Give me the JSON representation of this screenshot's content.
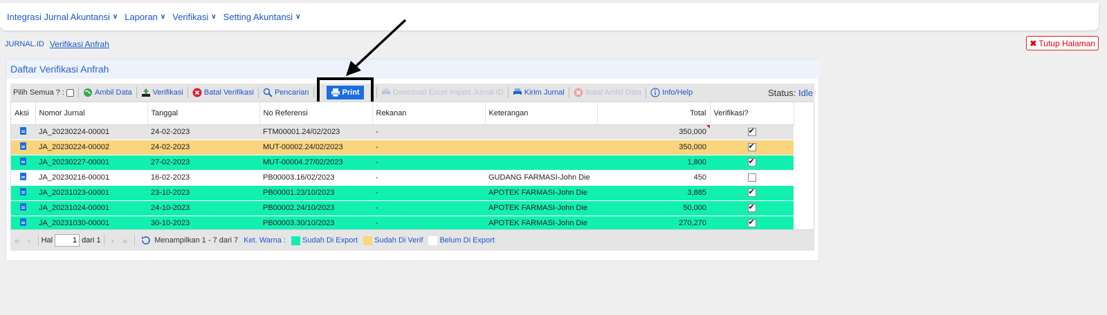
{
  "topnav": {
    "menus": [
      {
        "label": "Integrasi Jurnal Akuntansi"
      },
      {
        "label": "Laporan"
      },
      {
        "label": "Verifikasi"
      },
      {
        "label": "Setting Akuntansi"
      }
    ]
  },
  "breadcrumb": {
    "root": "JURNAL.ID",
    "current": "Verifikasi Anfrah"
  },
  "close_button": {
    "label": "Tutup Halaman"
  },
  "panel": {
    "title": "Daftar Verifikasi Anfrah"
  },
  "toolbar": {
    "select_all_label": "Pilih Semua ? :",
    "ambil_data": "Ambil Data",
    "verifikasi": "Verifikasi",
    "batal_verifikasi": "Batal Verifikasi",
    "pencarian": "Pencarian",
    "print": "Print",
    "download_excel": "Download Excel Import Jurnal ID",
    "kirim_jurnal": "Kirim Jurnal",
    "batal_ambil_data": "Batal Ambil Data",
    "info_help": "Info/Help",
    "status_label": "Status:",
    "status_value": "Idle"
  },
  "grid": {
    "columns": [
      "Aksi",
      "Nomor Jurnal",
      "Tanggal",
      "No Referensi",
      "Rekanan",
      "Keterangan",
      "Total",
      "Verifikasi?"
    ],
    "rows": [
      {
        "nomor": "JA_20230224-00001",
        "tanggal": "24-02-2023",
        "ref": "FTM00001.24/02/2023",
        "rekanan": "-",
        "keterangan": "",
        "total": "350,000",
        "verif": true,
        "bg": "#e5e5e5"
      },
      {
        "nomor": "JA_20230224-00002",
        "tanggal": "24-02-2023",
        "ref": "MUT-00002.24/02/2023",
        "rekanan": "-",
        "keterangan": "",
        "total": "350,000",
        "verif": true,
        "bg": "#fbd47e"
      },
      {
        "nomor": "JA_20230227-00001",
        "tanggal": "27-02-2023",
        "ref": "MUT-00004.27/02/2023",
        "rekanan": "-",
        "keterangan": "",
        "total": "1,800",
        "verif": true,
        "bg": "#12f0b0"
      },
      {
        "nomor": "JA_20230216-00001",
        "tanggal": "16-02-2023",
        "ref": "PB00003.16/02/2023",
        "rekanan": "-",
        "keterangan": "GUDANG FARMASI-John Die",
        "total": "450",
        "verif": false,
        "bg": "#ffffff"
      },
      {
        "nomor": "JA_20231023-00001",
        "tanggal": "23-10-2023",
        "ref": "PB00001.23/10/2023",
        "rekanan": "-",
        "keterangan": "APOTEK FARMASI-John Die",
        "total": "3,885",
        "verif": true,
        "bg": "#12f0b0"
      },
      {
        "nomor": "JA_20231024-00001",
        "tanggal": "24-10-2023",
        "ref": "PB00002.24/10/2023",
        "rekanan": "-",
        "keterangan": "APOTEK FARMASI-John Die",
        "total": "50,000",
        "verif": true,
        "bg": "#12f0b0"
      },
      {
        "nomor": "JA_20231030-00001",
        "tanggal": "30-10-2023",
        "ref": "PB00003.30/10/2023",
        "rekanan": "-",
        "keterangan": "APOTEK FARMASI-John Die",
        "total": "270,270",
        "verif": true,
        "bg": "#12f0b0"
      }
    ]
  },
  "pager": {
    "hal_label": "Hal",
    "page_value": "1",
    "of_label": "dari 1",
    "info": "Menampilkan 1 - 7 dari 7",
    "legend_label": "Ket. Warna :",
    "legend": [
      {
        "label": "Sudah Di Export",
        "color": "#12f0b0"
      },
      {
        "label": "Sudah Di Verif",
        "color": "#fbd47e"
      },
      {
        "label": "Belum Di Export",
        "color": "#ffffff"
      }
    ]
  }
}
